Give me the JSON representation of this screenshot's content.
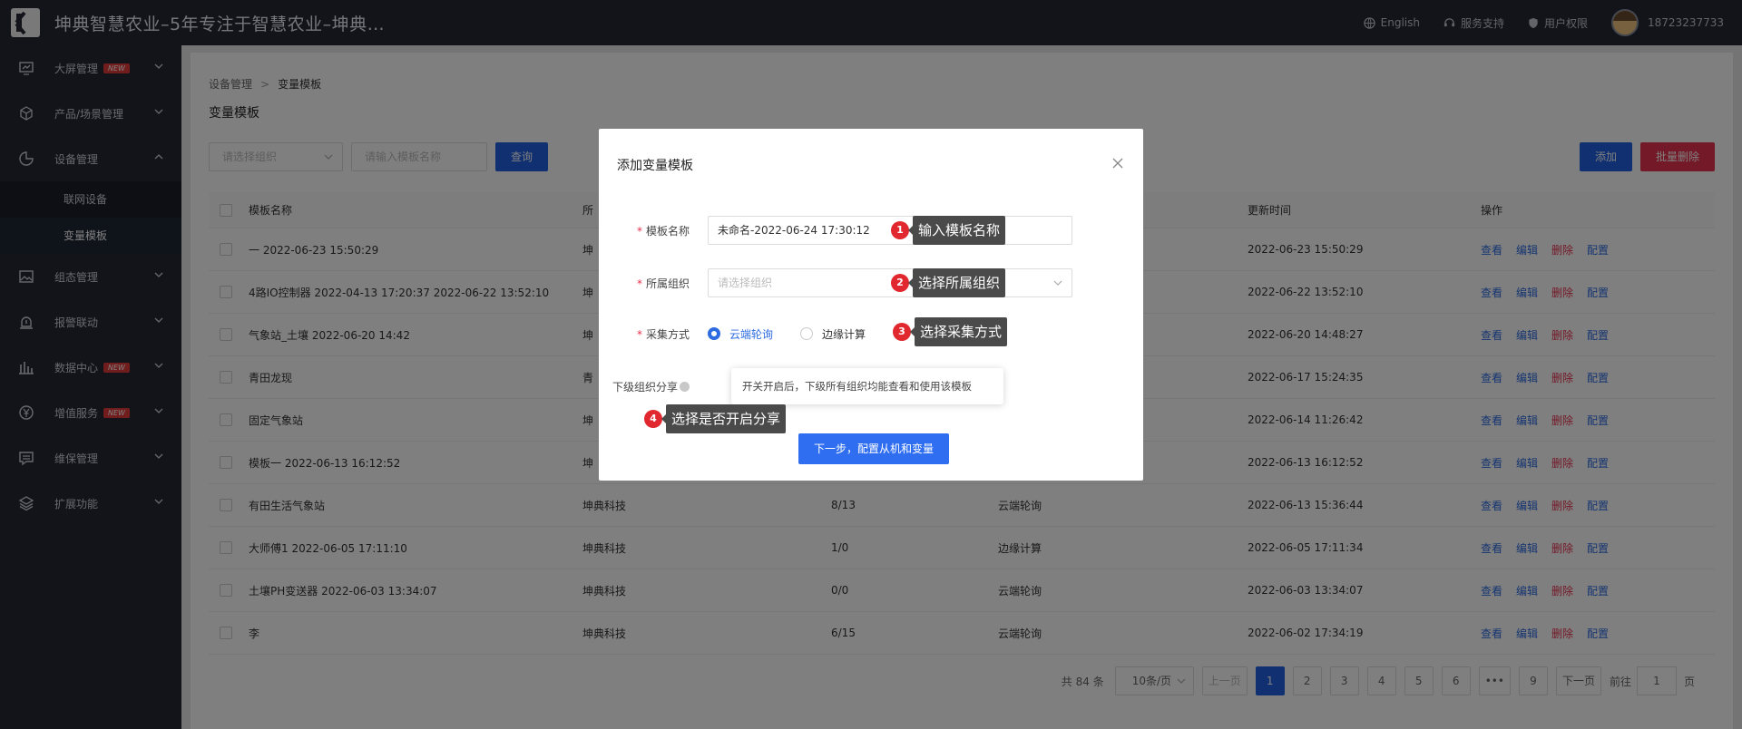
{
  "app": {
    "title": "坤典智慧农业–5年专注于智慧农业–坤典…"
  },
  "topbar": {
    "lang": "English",
    "support": "服务支持",
    "perm": "用户权限",
    "phone": "18723237733"
  },
  "sidebar": {
    "items": [
      {
        "label": "大屏管理",
        "badge": "NEW"
      },
      {
        "label": "产品/场景管理"
      },
      {
        "label": "设备管理"
      },
      {
        "label": "组态管理"
      },
      {
        "label": "报警联动"
      },
      {
        "label": "数据中心",
        "badge": "NEW"
      },
      {
        "label": "增值服务",
        "badge": "NEW"
      },
      {
        "label": "维保管理"
      },
      {
        "label": "扩展功能"
      }
    ],
    "sub": [
      "联网设备",
      "变量模板"
    ]
  },
  "breadcrumb": {
    "parent": "设备管理",
    "current": "变量模板"
  },
  "page_title": "变量模板",
  "filters": {
    "org_placeholder": "请选择组织",
    "name_placeholder": "请输入模板名称",
    "query": "查询"
  },
  "actions": {
    "add": "添加",
    "batch_delete": "批量删除"
  },
  "table": {
    "headers": {
      "name": "模板名称",
      "time": "更新时间",
      "ops": "操作",
      "org_partial": "所"
    },
    "ops": {
      "view": "查看",
      "edit": "编辑",
      "delete": "删除",
      "config": "配置"
    },
    "rows": [
      {
        "name": "一 2022-06-23 15:50:29",
        "org": "坤",
        "count": "",
        "mode": "",
        "time": "2022-06-23 15:50:29"
      },
      {
        "name": "4路IO控制器 2022-04-13 17:20:37 2022-06-22 13:52:10",
        "org": "坤",
        "count": "",
        "mode": "",
        "time": "2022-06-22 13:52:10"
      },
      {
        "name": "气象站_土壤 2022-06-20 14:42",
        "org": "坤",
        "count": "",
        "mode": "",
        "time": "2022-06-20 14:48:27"
      },
      {
        "name": "青田龙现",
        "org": "青",
        "count": "",
        "mode": "",
        "time": "2022-06-17 15:24:35"
      },
      {
        "name": "固定气象站",
        "org": "坤",
        "count": "",
        "mode": "",
        "time": "2022-06-14 11:26:42"
      },
      {
        "name": "模板一 2022-06-13 16:12:52",
        "org": "坤",
        "count": "",
        "mode": "",
        "time": "2022-06-13 16:12:52"
      },
      {
        "name": "有田生活气象站",
        "org": "坤典科技",
        "count": "8/13",
        "mode": "云端轮询",
        "time": "2022-06-13 15:36:44"
      },
      {
        "name": "大师傅1 2022-06-05 17:11:10",
        "org": "坤典科技",
        "count": "1/0",
        "mode": "边缘计算",
        "time": "2022-06-05 17:11:34"
      },
      {
        "name": "土壤PH变送器 2022-06-03 13:34:07",
        "org": "坤典科技",
        "count": "0/0",
        "mode": "云端轮询",
        "time": "2022-06-03 13:34:07"
      },
      {
        "name": "李",
        "org": "坤典科技",
        "count": "6/15",
        "mode": "云端轮询",
        "time": "2022-06-02 17:34:19"
      }
    ]
  },
  "pager": {
    "total": "共 84 条",
    "size": "10条/页",
    "prev": "上一页",
    "pages": [
      "1",
      "2",
      "3",
      "4",
      "5",
      "6",
      "•••",
      "9"
    ],
    "next": "下一页",
    "goto": "前往",
    "goto_value": "1",
    "page_unit": "页"
  },
  "modal": {
    "title": "添加变量模板",
    "name_label": "模板名称",
    "name_value": "未命名-2022-06-24 17:30:12",
    "org_label": "所属组织",
    "org_placeholder": "请选择组织",
    "mode_label": "采集方式",
    "mode_cloud": "云端轮询",
    "mode_edge": "边缘计算",
    "share_label": "下级组织分享",
    "share_tip": "开关开启后，下级所有组织均能查看和使用该模板",
    "next_btn": "下一步，配置从机和变量"
  },
  "callouts": [
    {
      "num": "1",
      "text": "输入模板名称"
    },
    {
      "num": "2",
      "text": "选择所属组织"
    },
    {
      "num": "3",
      "text": "选择采集方式"
    },
    {
      "num": "4",
      "text": "选择是否开启分享"
    }
  ]
}
